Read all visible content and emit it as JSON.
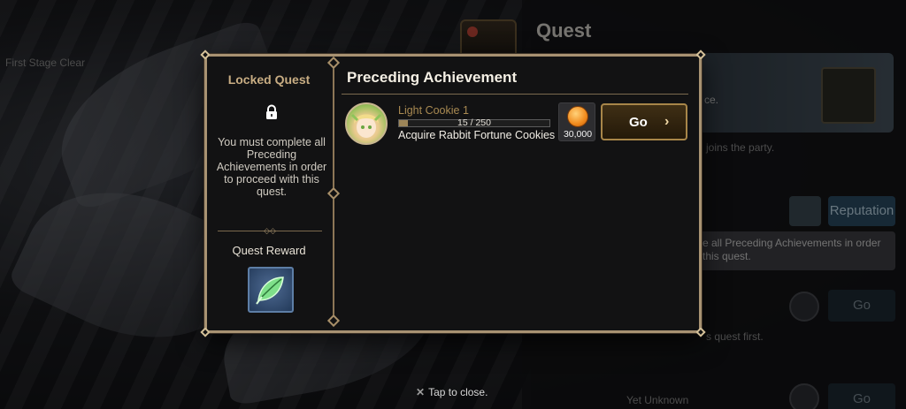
{
  "background": {
    "quest_title": "Quest",
    "reputation_button": "Reputation",
    "note": "e all Preceding Achievements in order this quest.",
    "go_label_1": "Go",
    "go_label_2": "Go",
    "fragments": [
      "First Stage Clear",
      "joins the party.",
      "s quest first.",
      "Yet Unknown",
      "ce."
    ]
  },
  "dialog": {
    "left": {
      "locked_title": "Locked Quest",
      "lock_icon": "lock-icon",
      "description": "You must complete all Preceding Achievements in order to proceed with this quest.",
      "reward_title": "Quest Reward",
      "reward_item_icon": "green-leaf-icon"
    },
    "right": {
      "title": "Preceding Achievement",
      "achievement": {
        "cookie_name": "Light Cookie 1",
        "progress_text": "15 / 250",
        "progress_fraction": 0.06,
        "task": "Acquire Rabbit Fortune Cookies",
        "reward_icon": "coin-icon",
        "reward_amount": "30,000",
        "go_label": "Go",
        "go_icon": "chevron-right-icon"
      }
    }
  },
  "close_hint": "Tap to close.",
  "close_icon": "close-icon",
  "colors": {
    "frame": "#a89272",
    "accent_gold": "#c8ad83",
    "go_border": "#a88649"
  }
}
